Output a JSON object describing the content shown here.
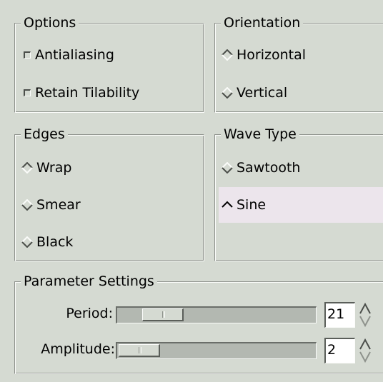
{
  "options": {
    "title": "Options",
    "antialiasing_label": "Antialiasing",
    "antialiasing_checked": false,
    "retain_tilability_label": "Retain Tilability",
    "retain_tilability_checked": false
  },
  "orientation": {
    "title": "Orientation",
    "horizontal_label": "Horizontal",
    "vertical_label": "Vertical",
    "selected": "Horizontal"
  },
  "edges": {
    "title": "Edges",
    "wrap_label": "Wrap",
    "smear_label": "Smear",
    "black_label": "Black",
    "selected": "Wrap"
  },
  "wave_type": {
    "title": "Wave Type",
    "sawtooth_label": "Sawtooth",
    "sine_label": "Sine",
    "selected": "Sine"
  },
  "parameters": {
    "title": "Parameter Settings",
    "period_label": "Period:",
    "period_value": "21",
    "amplitude_label": "Amplitude:",
    "amplitude_value": "2"
  },
  "colors": {
    "background": "#d5dad2",
    "hover_row": "#ece5ec"
  }
}
